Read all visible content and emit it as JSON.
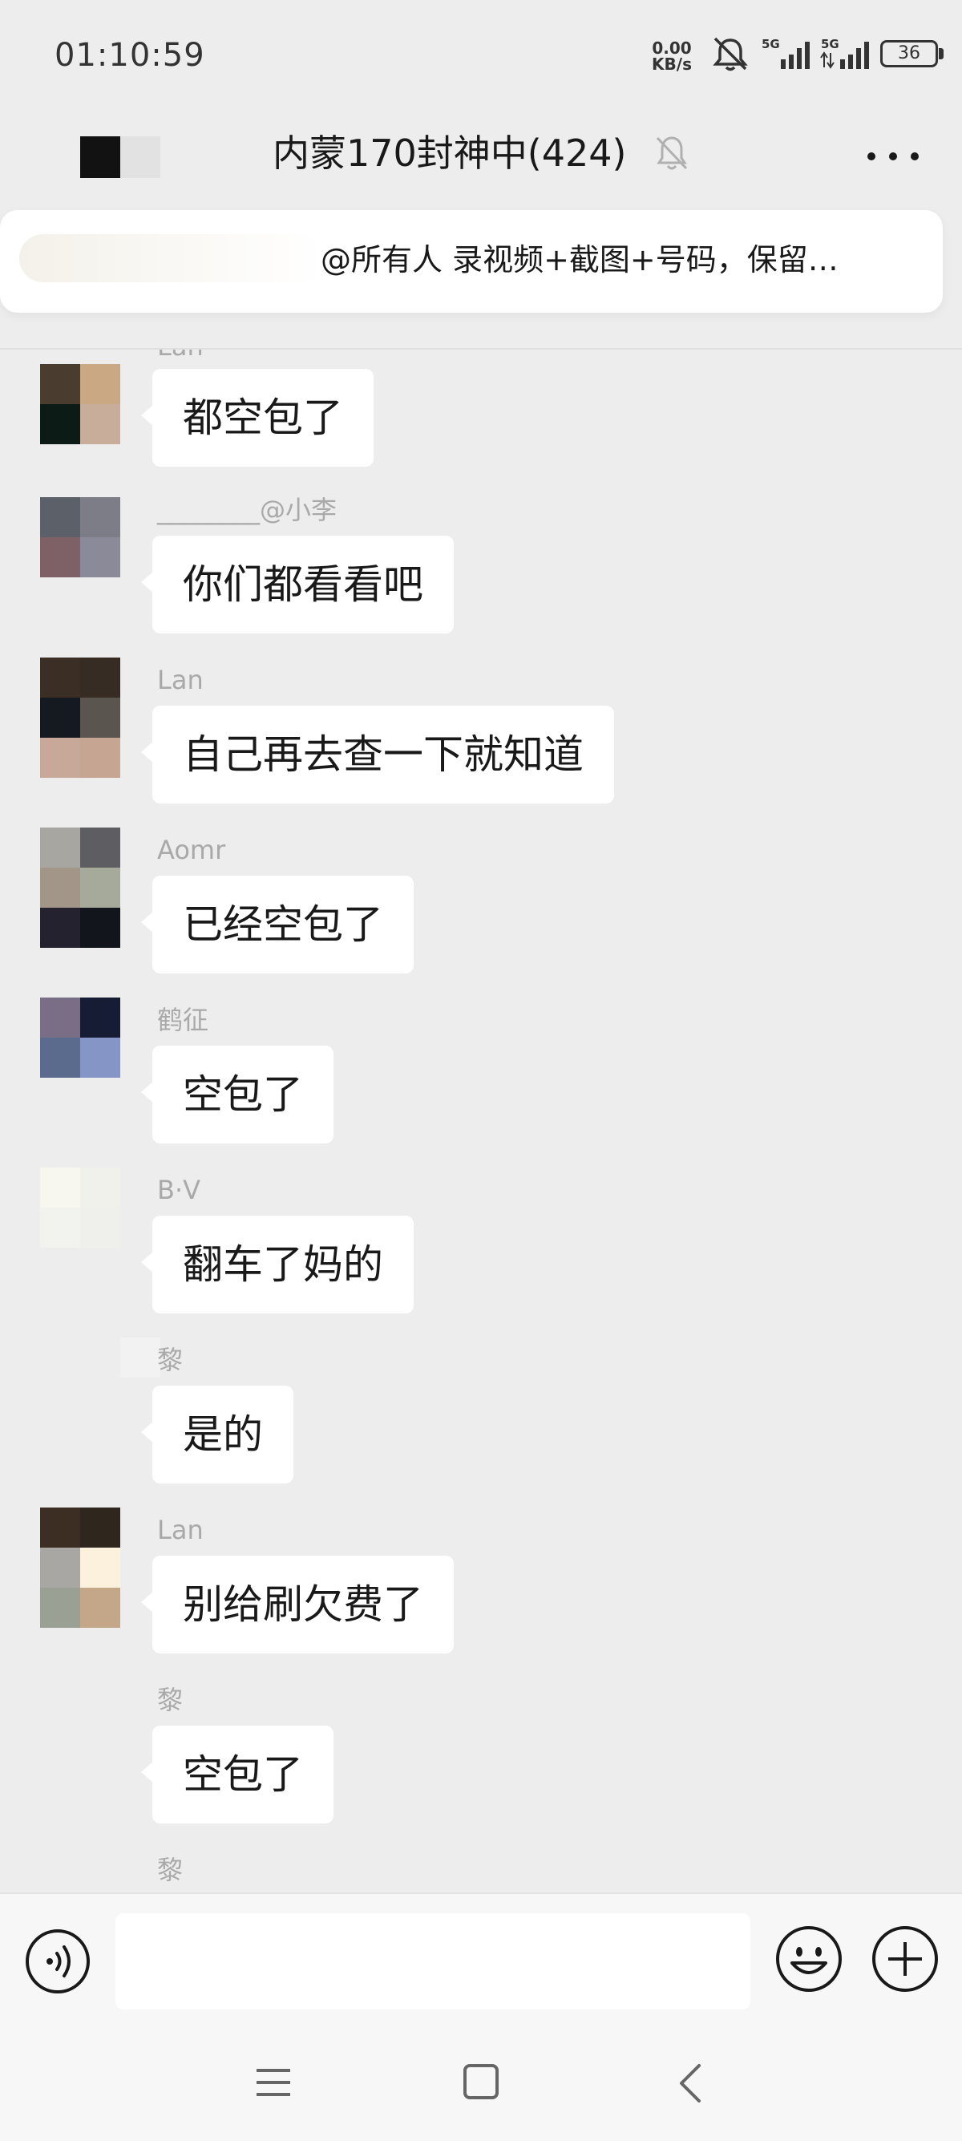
{
  "status_bar": {
    "time": "01:10:59",
    "net_speed_value": "0.00",
    "net_speed_unit": "KB/s",
    "network_1": "5G",
    "network_2": "5G",
    "battery": "36",
    "icons": [
      "mute-bell-icon",
      "signal-5g-icon",
      "signal-5g-icon",
      "battery-icon"
    ]
  },
  "header": {
    "title": "内蒙170封神中(424)",
    "back_icon": "back-avatar-block",
    "mute_icon": "muted-bell-icon",
    "more_icon": "more-dots-icon"
  },
  "pinned": {
    "text": "@所有人 录视频+截图+号码，保留…"
  },
  "messages": [
    {
      "sender": "Lan",
      "text": "都空包了"
    },
    {
      "sender": "________@小李",
      "text": "你们都看看吧"
    },
    {
      "sender": "Lan",
      "text": "自己再去查一下就知道"
    },
    {
      "sender": "Aomr",
      "text": "已经空包了"
    },
    {
      "sender": "鹤征",
      "text": "空包了"
    },
    {
      "sender": "B·V",
      "text": "翻车了妈的"
    },
    {
      "sender": "黎",
      "text": "是的"
    },
    {
      "sender": "Lan",
      "text": "别给刷欠费了"
    },
    {
      "sender": "黎",
      "text": "空包了"
    },
    {
      "sender": "黎",
      "text": ""
    }
  ],
  "input_bar": {
    "placeholder": "",
    "icons": [
      "voice-icon",
      "emoji-icon",
      "plus-icon"
    ]
  },
  "nav_bar": {
    "icons": [
      "menu-icon",
      "home-icon",
      "back-icon"
    ]
  },
  "colors": {
    "background": "#ededed",
    "bubble": "#ffffff",
    "sender_name": "#a9a9a9",
    "text": "#191919"
  }
}
